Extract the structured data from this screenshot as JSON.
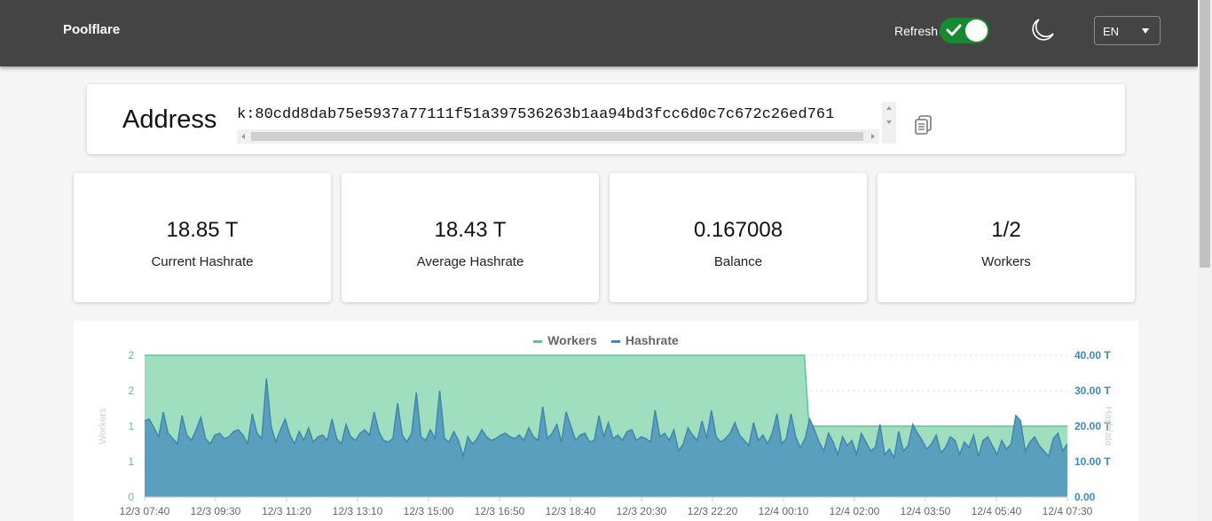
{
  "header": {
    "brand": "Poolflare",
    "refresh_label": "Refresh",
    "refresh_on": true,
    "language": "EN",
    "theme_icon": "moon-icon"
  },
  "address": {
    "title": "Address",
    "value": "k:80cdd8dab75e5937a77111f51a397536263b1aa94bd3fcc6d0c7c672c26ed761",
    "copy_icon": "copy-icon"
  },
  "stats": [
    {
      "value": "18.85 T",
      "label": "Current Hashrate"
    },
    {
      "value": "18.43 T",
      "label": "Average Hashrate"
    },
    {
      "value": "0.167008",
      "label": "Balance"
    },
    {
      "value": "1/2",
      "label": "Workers"
    }
  ],
  "colors": {
    "header_bg": "#444444",
    "toggle_on": "#168a2e",
    "workers_fill": "#9fdfc0",
    "workers_line": "#5cc694",
    "hashrate_fill": "#5b9fbf",
    "hashrate_line": "#3d88ad",
    "right_axis": "#3d88c0"
  },
  "chart_data": {
    "type": "area",
    "legend": [
      "Workers",
      "Hashrate"
    ],
    "legend_position": "top-center",
    "ylabel_left": "Workers",
    "ylabel_right": "Hashrate",
    "y_left_ticks": [
      "0",
      "1",
      "1",
      "2",
      "2"
    ],
    "y_right_ticks": [
      "0.00",
      "10.00 T",
      "20.00 T",
      "30.00 T",
      "40.00 T"
    ],
    "ylim_left": [
      0,
      2
    ],
    "ylim_right": [
      0,
      40
    ],
    "x_ticks": [
      "12/3 07:40",
      "12/3 09:30",
      "12/3 11:20",
      "12/3 13:10",
      "12/3 15:00",
      "12/3 16:50",
      "12/3 18:40",
      "12/3 20:30",
      "12/3 22:20",
      "12/4 00:10",
      "12/4 02:00",
      "12/4 03:50",
      "12/4 05:40",
      "12/4 07:30"
    ],
    "grid": true,
    "series": [
      {
        "name": "Workers",
        "axis": "left",
        "values": [
          2,
          2,
          2,
          2,
          2,
          2,
          2,
          2,
          2,
          2,
          2,
          2,
          2,
          2,
          2,
          2,
          2,
          2,
          2,
          2,
          2,
          2,
          2,
          2,
          2,
          2,
          2,
          2,
          2,
          2,
          2,
          2,
          2,
          2,
          2,
          2,
          2,
          2,
          2,
          2,
          2,
          2,
          2,
          2,
          2,
          2,
          2,
          2,
          2,
          2,
          2,
          2,
          2,
          2,
          2,
          2,
          2,
          2,
          2,
          2,
          2,
          2,
          2,
          2,
          2,
          2,
          2,
          2,
          2,
          2,
          2,
          2,
          2,
          2,
          2,
          2,
          2,
          2,
          2,
          2,
          2,
          2,
          2,
          2,
          2,
          2,
          2,
          2,
          2,
          2,
          2,
          2,
          2,
          2,
          2,
          2,
          2,
          2,
          2,
          2,
          2,
          2,
          2,
          2,
          2,
          2,
          2,
          2,
          2,
          2,
          2,
          2,
          2,
          2,
          2,
          2,
          2,
          2,
          2,
          2,
          2,
          2,
          2,
          2,
          2,
          2,
          2,
          2,
          2,
          2,
          2,
          2,
          2,
          2,
          2,
          2,
          2,
          2,
          2,
          2,
          2,
          2,
          2,
          2,
          1,
          1,
          1,
          1,
          1,
          1,
          1,
          1,
          1,
          1,
          1,
          1,
          1,
          1,
          1,
          1,
          1,
          1,
          1,
          1,
          1,
          1,
          1,
          1,
          1,
          1,
          1,
          1,
          1,
          1,
          1,
          1,
          1,
          1,
          1,
          1,
          1,
          1,
          1,
          1,
          1,
          1,
          1,
          1,
          1,
          1,
          1,
          1,
          1,
          1,
          1,
          1,
          1,
          1,
          1,
          1,
          1
        ]
      },
      {
        "name": "Hashrate",
        "axis": "right",
        "values": [
          21.5,
          22.0,
          19.5,
          17.0,
          24.0,
          18.0,
          16.5,
          15.0,
          23.0,
          17.5,
          16.0,
          19.0,
          22.5,
          16.5,
          15.0,
          17.5,
          18.0,
          16.5,
          17.0,
          18.5,
          19.0,
          17.5,
          15.0,
          23.5,
          18.0,
          16.5,
          33.5,
          20.0,
          15.5,
          19.0,
          22.0,
          17.5,
          15.0,
          18.5,
          16.0,
          19.5,
          15.5,
          17.0,
          17.5,
          16.0,
          22.0,
          16.5,
          15.0,
          20.5,
          17.0,
          16.0,
          18.0,
          19.0,
          17.5,
          24.0,
          18.5,
          16.0,
          15.5,
          16.5,
          26.5,
          17.5,
          15.5,
          18.0,
          29.5,
          17.0,
          16.0,
          19.0,
          16.5,
          30.0,
          16.5,
          15.5,
          18.5,
          16.0,
          11.5,
          17.0,
          15.0,
          16.5,
          19.0,
          17.0,
          16.0,
          16.5,
          17.5,
          18.0,
          17.0,
          16.5,
          17.5,
          16.0,
          19.5,
          17.0,
          16.0,
          25.5,
          16.5,
          18.0,
          20.5,
          15.5,
          24.0,
          20.0,
          16.0,
          17.5,
          18.0,
          15.5,
          16.0,
          23.0,
          17.0,
          21.0,
          16.5,
          17.5,
          16.0,
          18.5,
          19.0,
          16.0,
          17.0,
          16.5,
          15.5,
          24.5,
          17.0,
          18.0,
          16.0,
          19.0,
          13.0,
          15.0,
          19.5,
          17.5,
          16.0,
          21.5,
          16.5,
          24.5,
          17.0,
          15.5,
          16.5,
          18.0,
          21.0,
          17.5,
          16.0,
          14.5,
          21.0,
          16.0,
          17.5,
          15.0,
          18.0,
          23.5,
          15.0,
          16.5,
          23.5,
          17.0,
          14.0,
          16.5,
          22.0,
          19.0,
          15.5,
          13.0,
          18.0,
          15.5,
          12.0,
          17.0,
          14.5,
          16.0,
          12.0,
          18.0,
          15.5,
          13.0,
          14.0,
          20.5,
          12.0,
          13.5,
          11.0,
          18.5,
          13.0,
          14.5,
          20.5,
          18.0,
          16.0,
          13.5,
          15.0,
          17.5,
          12.5,
          14.0,
          17.0,
          16.0,
          12.0,
          15.5,
          14.0,
          17.5,
          11.5,
          16.0,
          17.0,
          14.5,
          12.0,
          16.0,
          13.5,
          15.0,
          23.0,
          21.5,
          13.0,
          15.5,
          17.0,
          14.5,
          13.0,
          11.5,
          16.5,
          18.0,
          13.0,
          15.0
        ]
      }
    ]
  }
}
